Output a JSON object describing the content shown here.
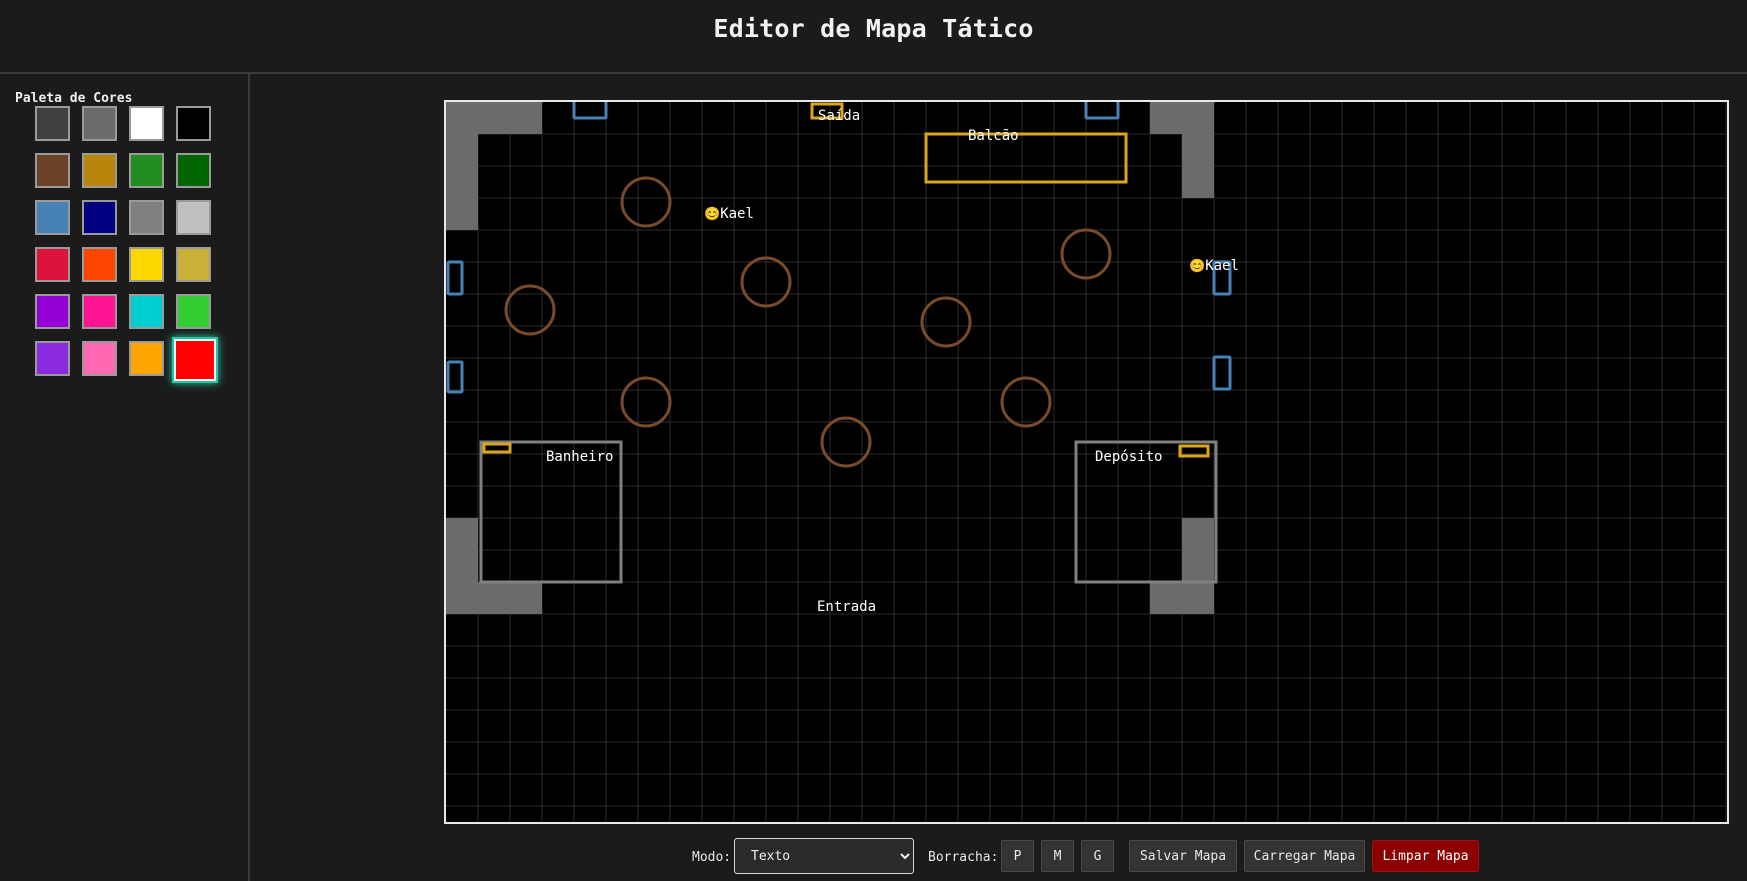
{
  "header": {
    "title": "Editor de Mapa Tático"
  },
  "palette": {
    "label": "Paleta de Cores",
    "selected_index": 23,
    "colors": [
      "#404040",
      "#6b6b6b",
      "#ffffff",
      "#000000",
      "#6b4226",
      "#b8860b",
      "#228b22",
      "#006400",
      "#4682b4",
      "#000080",
      "#808080",
      "#c0c0c0",
      "#dc143c",
      "#ff4500",
      "#ffd700",
      "#c9b037",
      "#9400d3",
      "#ff1493",
      "#00ced1",
      "#32cd32",
      "#8a2be2",
      "#ff69b4",
      "#ffa500",
      "#ff0000"
    ]
  },
  "map": {
    "background": "#000000",
    "grid_color": "#2c2c2c",
    "wall_color": "#6b6b6b",
    "labels": {
      "saida": "Saída",
      "balcao": "Balcão",
      "banheiro": "Banheiro",
      "deposito": "Depósito",
      "entrada": "Entrada",
      "token_1": "Kael",
      "token_2": "Kael"
    },
    "label_color": "#ffd700",
    "token_color": "#ff2020",
    "token_icon": "smiley-face-icon",
    "token_glyph": "😊",
    "table_color": "#7a4a2a",
    "window_color": "#4682b4",
    "door_color": "#daa520",
    "room_wall_color": "#808080"
  },
  "toolbar": {
    "mode_label": "Modo:",
    "mode_value": "Texto",
    "mode_options": [
      "Texto"
    ],
    "eraser_label": "Borracha:",
    "eraser_small": "P",
    "eraser_medium": "M",
    "eraser_large": "G",
    "save_label": "Salvar Mapa",
    "load_label": "Carregar Mapa",
    "clear_label": "Limpar Mapa"
  }
}
